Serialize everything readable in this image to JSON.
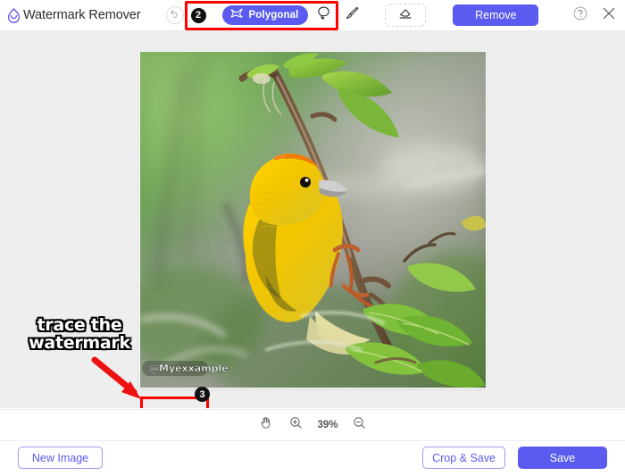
{
  "app": {
    "title": "Watermark Remover",
    "logo_icon": "water-drop-logo"
  },
  "header": {
    "undo_icon": "undo-arrow-icon",
    "step_badge_2": "2",
    "tools": [
      {
        "id": "polygonal",
        "label": "Polygonal",
        "icon": "polygonal-lasso-icon",
        "active": true
      },
      {
        "id": "lasso",
        "label": "",
        "icon": "lasso-icon",
        "active": false
      },
      {
        "id": "brush",
        "label": "",
        "icon": "brush-icon",
        "active": false
      }
    ],
    "eraser": {
      "label": "",
      "icon": "eraser-icon"
    },
    "remove_label": "Remove",
    "help_icon": "question-mark-icon",
    "close_icon": "close-x-icon"
  },
  "canvas": {
    "background_color": "#eeeeee",
    "annotation_text_line1": "trace the",
    "annotation_text_line2": "watermark",
    "arrow_icon": "red-arrow-icon",
    "watermark_text": "@Myexxample",
    "step_badge_3": "3",
    "selection_color": "#ff0000",
    "photo_alt": "yellow weaver bird perched on a branch with green leaves"
  },
  "zoombar": {
    "hand_icon": "hand-pan-icon",
    "zoom_in_icon": "zoom-in-icon",
    "zoom_level": "39%",
    "zoom_out_icon": "zoom-out-icon"
  },
  "footer": {
    "new_image_label": "New Image",
    "crop_save_label": "Crop & Save",
    "save_label": "Save"
  },
  "colors": {
    "accent": "#5b5bef",
    "annotation": "#ff0000",
    "canvas_bg": "#eeeeee"
  }
}
